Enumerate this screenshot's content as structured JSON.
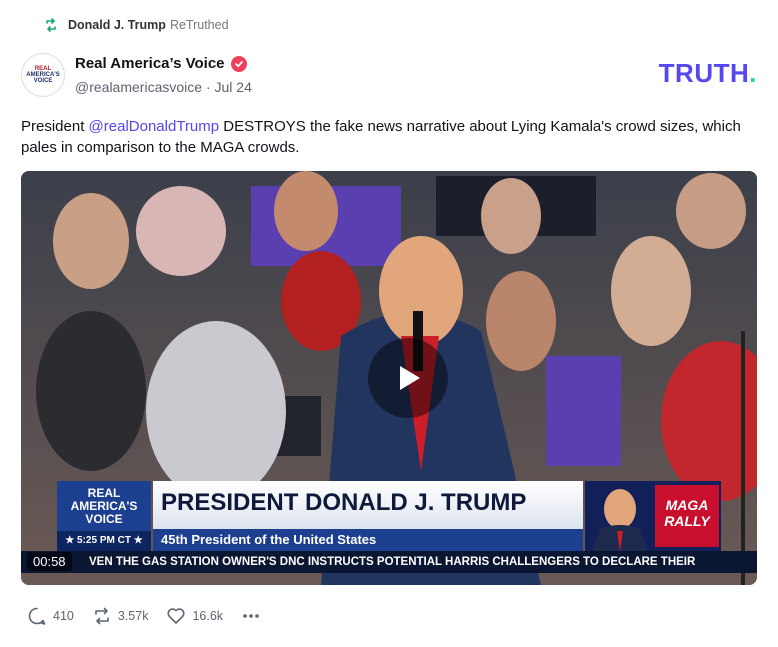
{
  "retruth": {
    "user": "Donald J. Trump",
    "label": "ReTruthed"
  },
  "author": {
    "name": "Real America’s Voice",
    "handle": "@realamericasvoice",
    "date": "Jul 24",
    "avatar_text_1": "REAL",
    "avatar_text_2": "AMERICA'S",
    "avatar_text_3": "VOICE"
  },
  "brand": {
    "logo": "TRUTH",
    "logo_dot": "."
  },
  "post": {
    "before": "President ",
    "mention": "@realDonaldTrump",
    "after": " DESTROYS the fake news narrative about Lying Kamala's crowd sizes, which pales in comparison to the MAGA crowds."
  },
  "video": {
    "duration": "00:58",
    "lower_third_logo_1": "REAL",
    "lower_third_logo_2": "AMERICA'S",
    "lower_third_logo_3": "VOICE",
    "lower_third_time": "★ 5:25 PM CT ★",
    "lower_third_title": "PRESIDENT DONALD J. TRUMP",
    "lower_third_subtitle": "45th President of the United States",
    "inset_text_1": "MAGA",
    "inset_text_2": "RALLY",
    "ticker": "VEN THE GAS STATION OWNER'S    DNC INSTRUCTS POTENTIAL HARRIS CHALLENGERS TO DECLARE THEIR"
  },
  "stats": {
    "replies": "410",
    "retruths": "3.57k",
    "likes": "16.6k"
  },
  "colors": {
    "accent": "#5448ee",
    "verified": "#ef3f5b",
    "retruth": "#17a86e"
  }
}
